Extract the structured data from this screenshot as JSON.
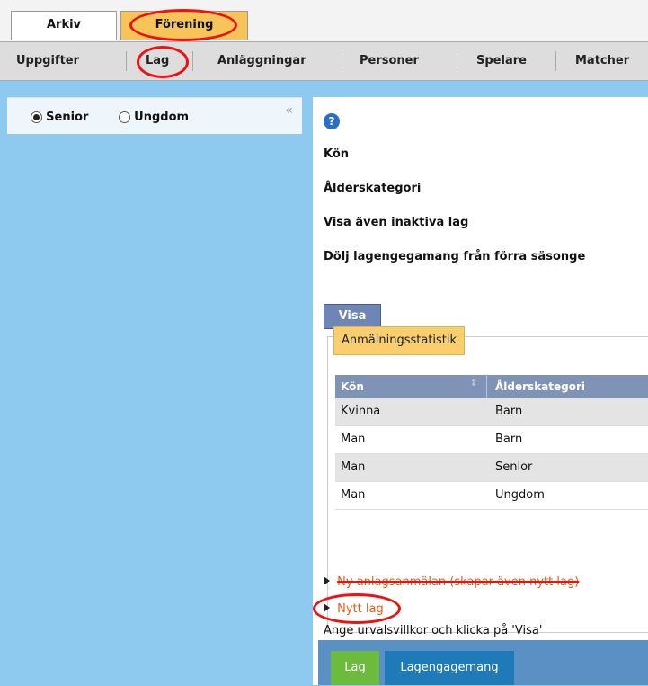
{
  "top_tabs": {
    "arkiv": "Arkiv",
    "forening": "Förening"
  },
  "nav": [
    "Uppgifter",
    "Lag",
    "Anläggningar",
    "Personer",
    "Spelare",
    "Matcher"
  ],
  "sidebar": {
    "radio_senior": "Senior",
    "radio_ungdom": "Ungdom",
    "collapse_glyph": "«"
  },
  "main": {
    "help_glyph": "?",
    "fields": [
      "Kön",
      "Ålderskategori",
      "Visa även inaktiva lag",
      "Dölj lagengegamang från förra säsonge"
    ],
    "visa_button": "Visa",
    "stats": {
      "legend": "Anmälningsstatistik",
      "columns": [
        "Kön",
        "Ålderskategori"
      ],
      "rows": [
        [
          "Kvinna",
          "Barn"
        ],
        [
          "Man",
          "Barn"
        ],
        [
          "Man",
          "Senior"
        ],
        [
          "Man",
          "Ungdom"
        ]
      ]
    },
    "links": {
      "new_registration": "Ny anlagsanmälan (skapar även nytt lag)",
      "new_team": "Nytt lag"
    },
    "hint": "Ange urvalsvillkor och klicka på 'Visa'",
    "bottom_tabs": [
      "Lag",
      "Lagengagemang"
    ]
  },
  "colors": {
    "annotation": "#e11111",
    "active_tab": "#f7c45a",
    "link": "#e85a1a"
  }
}
